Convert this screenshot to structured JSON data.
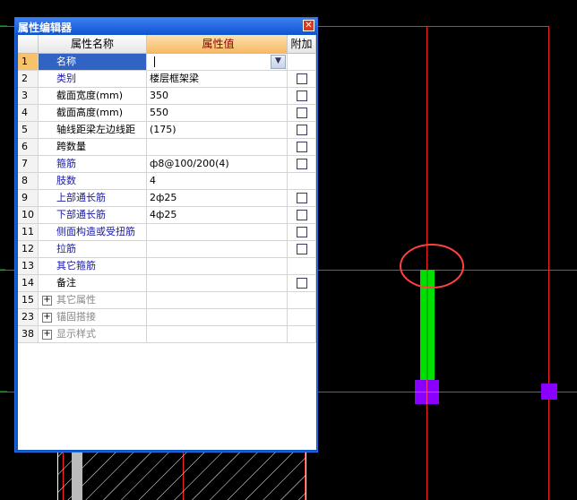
{
  "window": {
    "title": "属性编辑器"
  },
  "columns": {
    "name": "属性名称",
    "value": "属性值",
    "add": "附加"
  },
  "rows": [
    {
      "num": "1",
      "name": "名称",
      "value": "",
      "style": "selected",
      "checkbox": false,
      "expander": false
    },
    {
      "num": "2",
      "name": "类别",
      "value": "楼层框架梁",
      "style": "blue",
      "checkbox": true,
      "expander": false
    },
    {
      "num": "3",
      "name": "截面宽度(mm)",
      "value": "350",
      "style": "black",
      "checkbox": true,
      "expander": false
    },
    {
      "num": "4",
      "name": "截面高度(mm)",
      "value": "550",
      "style": "black",
      "checkbox": true,
      "expander": false
    },
    {
      "num": "5",
      "name": "轴线距梁左边线距",
      "value": "(175)",
      "style": "black",
      "checkbox": true,
      "expander": false
    },
    {
      "num": "6",
      "name": "跨数量",
      "value": "",
      "style": "black",
      "checkbox": true,
      "expander": false
    },
    {
      "num": "7",
      "name": "箍筋",
      "value": "ф8@100/200(4)",
      "style": "blue",
      "checkbox": true,
      "expander": false
    },
    {
      "num": "8",
      "name": "肢数",
      "value": "4",
      "style": "blue",
      "checkbox": false,
      "expander": false
    },
    {
      "num": "9",
      "name": "上部通长筋",
      "value": "2ф25",
      "style": "blue",
      "checkbox": true,
      "expander": false
    },
    {
      "num": "10",
      "name": "下部通长筋",
      "value": "4ф25",
      "style": "blue",
      "checkbox": true,
      "expander": false
    },
    {
      "num": "11",
      "name": "侧面构造或受扭筋",
      "value": "",
      "style": "blue",
      "checkbox": true,
      "expander": false
    },
    {
      "num": "12",
      "name": "拉筋",
      "value": "",
      "style": "blue",
      "checkbox": true,
      "expander": false
    },
    {
      "num": "13",
      "name": "其它箍筋",
      "value": "",
      "style": "blue",
      "checkbox": false,
      "expander": false
    },
    {
      "num": "14",
      "name": "备注",
      "value": "",
      "style": "black",
      "checkbox": true,
      "expander": false
    },
    {
      "num": "15",
      "name": "其它属性",
      "value": "",
      "style": "grey",
      "checkbox": false,
      "expander": true
    },
    {
      "num": "23",
      "name": "锚固搭接",
      "value": "",
      "style": "grey",
      "checkbox": false,
      "expander": true
    },
    {
      "num": "38",
      "name": "显示样式",
      "value": "",
      "style": "grey",
      "checkbox": false,
      "expander": true
    }
  ],
  "icons": {
    "close": "close-icon",
    "combo": "chevron-down-icon",
    "expand": "plus-icon"
  },
  "colors": {
    "background": "#000000",
    "gridline": "#ff0000",
    "beam": "#00e000",
    "node": "#8a00ff",
    "highlight_circle": "#ff4040",
    "hatch": "#ffffff"
  }
}
